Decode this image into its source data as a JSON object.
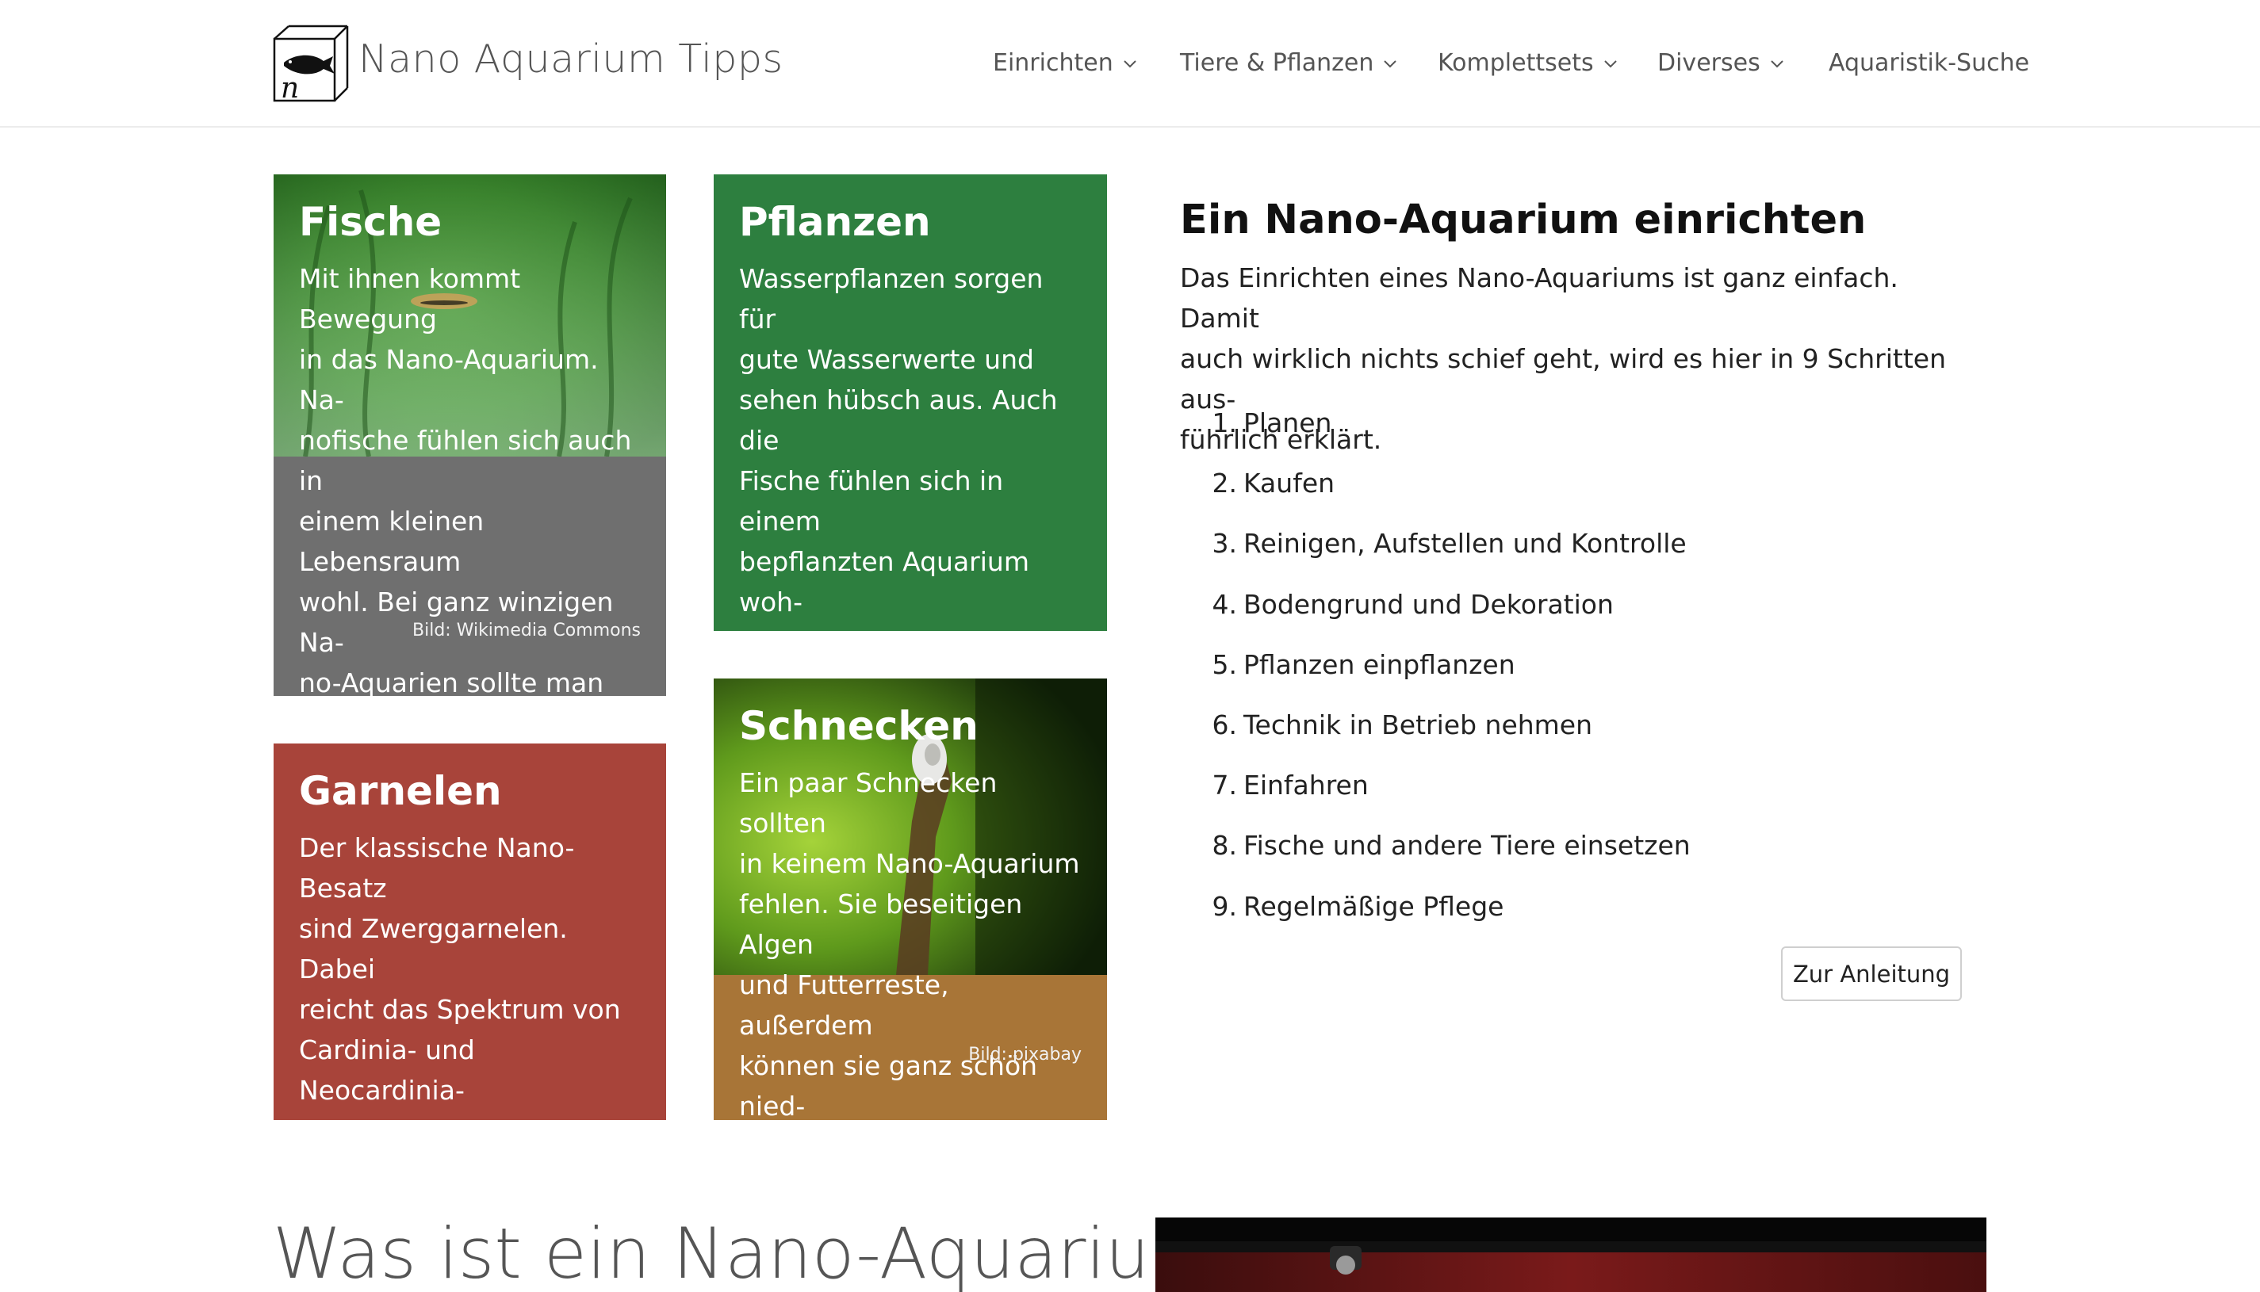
{
  "header": {
    "site_title": "Nano Aquarium Tipps",
    "logo_letter": "n",
    "nav": [
      {
        "label": "Einrichten",
        "dropdown": true
      },
      {
        "label": "Tiere & Pflanzen",
        "dropdown": true
      },
      {
        "label": "Komplettsets",
        "dropdown": true
      },
      {
        "label": "Diverses",
        "dropdown": true
      },
      {
        "label": "Aquaristik-Suche",
        "dropdown": false
      }
    ]
  },
  "cards": {
    "fische": {
      "title": "Fische",
      "text": "Mit ihnen kommt Bewegung\nin das Nano-Aquarium. Na-\nnofische fühlen sich auch in\neinem kleinen Lebensraum\nwohl. Bei ganz winzigen Na-\nno-Aquarien sollte man al-\nlerdings auf Wirbellose aus-\nweichen.",
      "credit": "Bild: Wikimedia Commons",
      "color": "#6f6f6f"
    },
    "pflanzen": {
      "title": "Pflanzen",
      "text": "Wasserpflanzen sorgen für\ngute Wasserwerte und\nsehen hübsch aus. Auch die\nFische fühlen sich in einem\nbepflanzten Aquarium woh-\nler. Welche Pflanzen passen\nam besten in ein Nano-\nAquarium?",
      "color": "#2d7f3f"
    },
    "garnelen": {
      "title": "Garnelen",
      "text": "Der klassische Nano-Besatz\nsind Zwerggarnelen. Dabei\nreicht das Spektrum von\nCardinia- und Neocardinia-\nbis hin zu exotischen Sual-\nwesi-Garnelen.",
      "color": "#a8443a"
    },
    "schnecken": {
      "title": "Schnecken",
      "text": "Ein paar Schnecken sollten\nin keinem Nano-Aquarium\nfehlen. Sie beseitigen Algen\nund Futterreste, außerdem\nkönnen sie ganz schön nied-\nlich sein.",
      "credit": "Bild: pixabay",
      "color": "#a87537"
    }
  },
  "main": {
    "heading": "Ein Nano-Aquarium einrichten",
    "intro": "Das Einrichten eines Nano-Aquariums ist ganz einfach. Damit\nauch wirklich nichts schief geht, wird es hier in 9 Schritten aus-\nführlich erklärt.",
    "steps": [
      {
        "num": "1.",
        "label": "Planen"
      },
      {
        "num": "2.",
        "label": "Kaufen"
      },
      {
        "num": "3.",
        "label": "Reinigen, Aufstellen und Kontrolle"
      },
      {
        "num": "4.",
        "label": "Bodengrund und Dekoration"
      },
      {
        "num": "5.",
        "label": "Pflanzen einpflanzen"
      },
      {
        "num": "6.",
        "label": "Technik in Betrieb nehmen"
      },
      {
        "num": "7.",
        "label": "Einfahren"
      },
      {
        "num": "8.",
        "label": "Fische und andere Tiere einsetzen"
      },
      {
        "num": "9.",
        "label": "Regelmäßige Pflege"
      }
    ],
    "button_label": "Zur Anleitung"
  },
  "bottom": {
    "heading": "Was ist ein Nano-Aquarium?"
  }
}
